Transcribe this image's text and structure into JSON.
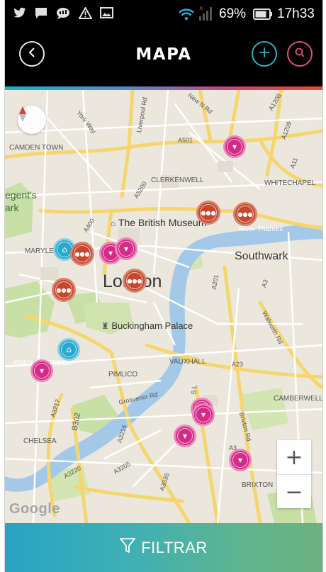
{
  "status_bar": {
    "icons": [
      "twitter-icon",
      "chat-icon",
      "messenger-icon",
      "warning-icon",
      "image-icon",
      "wifi-icon",
      "signal-icon",
      "battery-icon"
    ],
    "battery": "69%",
    "time": "17h33"
  },
  "header": {
    "title": "MAPA",
    "back_icon": "chevron-left-icon",
    "add_icon": "plus-icon",
    "search_icon": "search-icon",
    "colors": {
      "add": "#2fb3c8",
      "search": "#e0507a"
    }
  },
  "map": {
    "labels": {
      "camden_town": "CAMDEN TOWN",
      "regents": "egent's",
      "park": "ark",
      "york_way": "York Way",
      "liverpool_rd": "Liverpool Rd",
      "new_n_rd": "New N Rd",
      "a501": "A501",
      "a1208": "A1208",
      "a1209": "A1209",
      "a11": "A11",
      "whitechapel": "WHITECHAPEL",
      "clerkenwell": "CLERKENWELL",
      "a5200": "A5200",
      "a400": "A400",
      "british_museum": "The British Museum",
      "river_thames": "River Thames",
      "southwark": "Southwark",
      "marylebone": "MARYLE",
      "london": "London",
      "a201": "A201",
      "a3": "A3",
      "buckingham_palace": "Buckingham Palace",
      "walworth_rd": "Walworth Rd",
      "knightsbridge": "KNIGHTSBRIDGE",
      "pimlico": "PIMLICO",
      "vauxhall": "VAUXHALL",
      "camberwell": "CAMBERWELL",
      "grosvenor_rd": "Grosvenor Rd",
      "a3217": "A3217",
      "b302": "B302",
      "a3216": "A3216",
      "chelsea": "CHELSEA",
      "a3220": "A3220",
      "a3205": "A3205",
      "a3036": "A3036",
      "brixton_rd": "Brixton Rd",
      "brixton": "BRIXTON",
      "a23": "A23",
      "sl": "S L",
      "a3b": "A3"
    },
    "pins": [
      {
        "type": "bar",
        "icon": "cocktail-icon",
        "color": "#d42c86"
      },
      {
        "type": "restaurant",
        "icon": "plate-icon",
        "color": "#c7472e"
      },
      {
        "type": "restaurant",
        "icon": "plate-icon",
        "color": "#c7472e"
      },
      {
        "type": "attraction",
        "icon": "monument-icon",
        "color": "#2aa7cc"
      },
      {
        "type": "restaurant",
        "icon": "plate-icon",
        "color": "#c7472e"
      },
      {
        "type": "bar",
        "icon": "cocktail-icon",
        "color": "#d42c86"
      },
      {
        "type": "bar",
        "icon": "cocktail-icon",
        "color": "#d42c86"
      },
      {
        "type": "restaurant",
        "icon": "plate-icon",
        "color": "#c7472e"
      },
      {
        "type": "restaurant",
        "icon": "plate-icon",
        "color": "#c7472e"
      },
      {
        "type": "attraction",
        "icon": "monument-icon",
        "color": "#2aa7cc"
      },
      {
        "type": "bar",
        "icon": "cocktail-icon",
        "color": "#d42c86"
      },
      {
        "type": "bar",
        "icon": "cocktail-icon",
        "color": "#d42c86"
      },
      {
        "type": "bar",
        "icon": "cocktail-icon",
        "color": "#d42c86"
      },
      {
        "type": "bar",
        "icon": "cocktail-icon",
        "color": "#d42c86"
      },
      {
        "type": "bar",
        "icon": "cocktail-icon",
        "color": "#d42c86"
      }
    ],
    "zoom_in": "+",
    "zoom_out": "−",
    "attribution": "Google"
  },
  "footer": {
    "filter_label": "FILTRAR",
    "filter_icon": "funnel-icon"
  }
}
